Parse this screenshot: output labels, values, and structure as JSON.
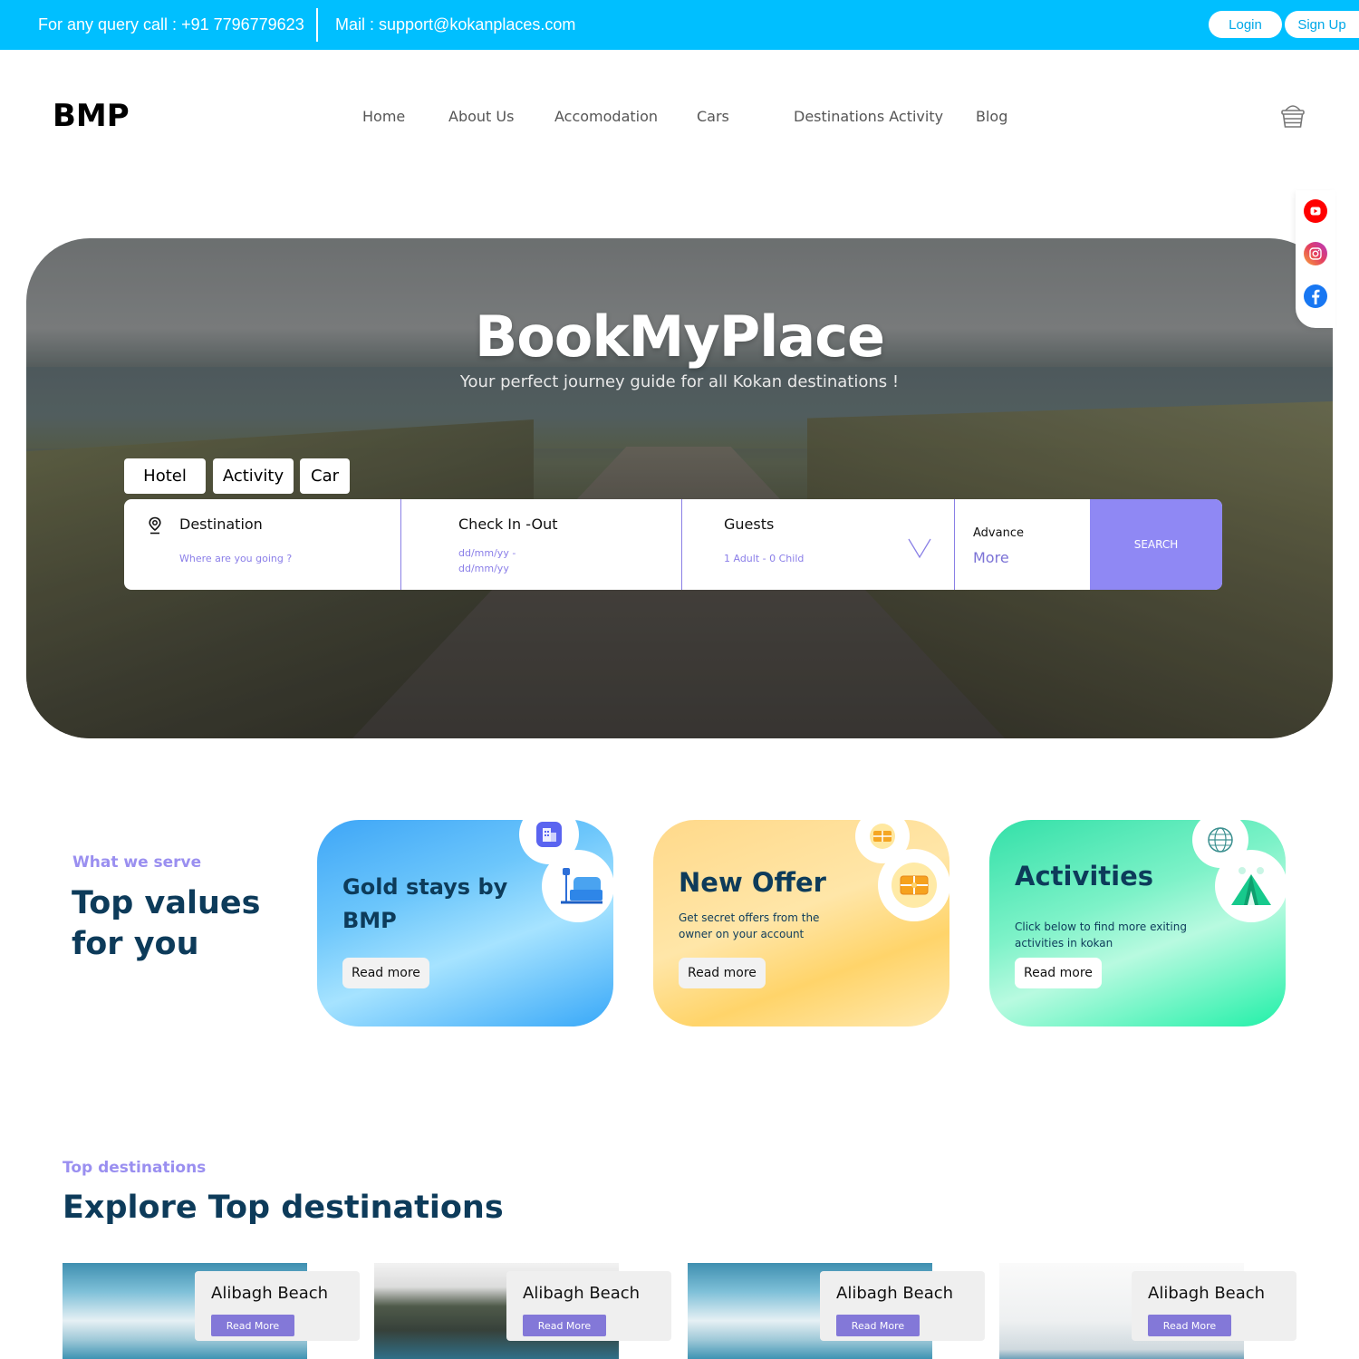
{
  "topbar": {
    "call": "For any query call : +91 7796779623",
    "mail": "Mail : support@kokanplaces.com",
    "login": "Login",
    "signup": "Sign Up"
  },
  "header": {
    "logo": "BMP",
    "nav": [
      "Home",
      "About Us",
      "Accomodation",
      "Cars",
      "Destinations Activity",
      "Blog"
    ],
    "cart_icon": "cart-icon"
  },
  "social": [
    "youtube-icon",
    "instagram-icon",
    "facebook-icon"
  ],
  "hero": {
    "title": "BookMyPlace",
    "subtitle": "Your perfect journey guide for all Kokan destinations !"
  },
  "booking": {
    "tabs": [
      "Hotel",
      "Activity",
      "Car"
    ],
    "destination": {
      "label": "Destination",
      "placeholder": "Where are you going ?"
    },
    "dates": {
      "label": "Check In -Out",
      "line1": "dd/mm/yy -",
      "line2": "dd/mm/yy"
    },
    "guests": {
      "label": "Guests",
      "value": "1 Adult - 0 Child"
    },
    "advance": {
      "label": "Advance",
      "more": "More"
    },
    "search": "SEARCH"
  },
  "serve": {
    "eyebrow": "What we serve",
    "heading_line1": "Top values",
    "heading_line2": "for you",
    "cards": [
      {
        "title_line1": "Gold stays by",
        "title_line2": "BMP",
        "desc_line1": "",
        "desc_line2": "",
        "button": "Read more"
      },
      {
        "title_line1": "New Offer",
        "title_line2": "",
        "desc_line1": "Get secret offers from the",
        "desc_line2": "owner on your account",
        "button": "Read more"
      },
      {
        "title_line1": "Activities",
        "title_line2": "",
        "desc_line1": "Click below to find more exiting",
        "desc_line2": "activities in kokan",
        "button": "Read more"
      }
    ]
  },
  "destinations": {
    "eyebrow": "Top destinations",
    "heading": "Explore Top destinations",
    "items": [
      {
        "name": "Alibagh Beach",
        "button": "Read More"
      },
      {
        "name": "Alibagh Beach",
        "button": "Read More"
      },
      {
        "name": "Alibagh Beach",
        "button": "Read More"
      },
      {
        "name": "Alibagh Beach",
        "button": "Read More"
      }
    ]
  },
  "colors": {
    "topbar": "#00bfff",
    "accent": "#8f88f4",
    "heading": "#0d3b5a",
    "eyebrow": "#9a8ff0"
  }
}
